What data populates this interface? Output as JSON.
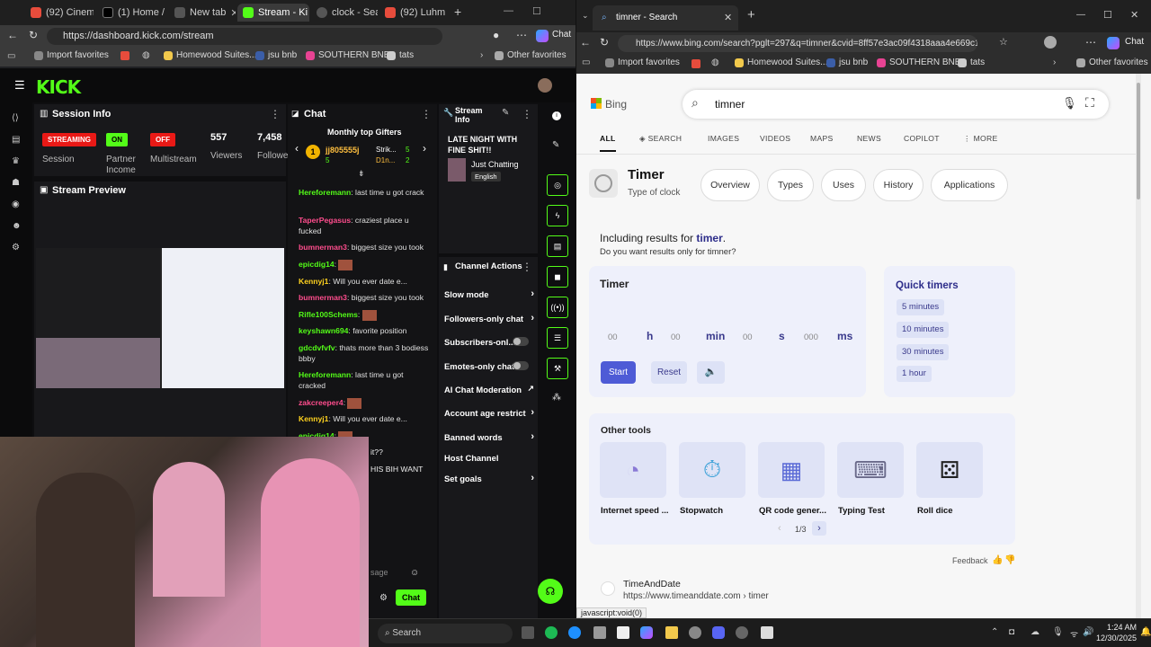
{
  "left_browser": {
    "tabs": [
      {
        "title": "(92) Cinem",
        "color": "#e74c3c"
      },
      {
        "title": "(1) Home /",
        "color": "#ffffff"
      },
      {
        "title": "New tab",
        "color": "#888888"
      },
      {
        "title": "Stream - Ki",
        "color": "#53fc18"
      },
      {
        "title": "clock - Sear",
        "color": "#555555"
      },
      {
        "title": "(92) Luhm",
        "color": "#e74c3c"
      }
    ],
    "url": "https://dashboard.kick.com/stream",
    "chat_label": "Chat",
    "favorites": [
      "Import favorites",
      "Homewood Suites...",
      "jsu bnb",
      "SOUTHERN BNB'",
      "tats",
      "Other favorites"
    ]
  },
  "kick": {
    "logo": "KICK",
    "session": {
      "title": "Session Info",
      "streaming_badge": "STREAMING",
      "on_badge": "ON",
      "off_badge": "OFF",
      "session_label": "Session",
      "partner_label": "Partner Income",
      "multistream_label": "Multistream",
      "viewers_value": "557",
      "viewers_label": "Viewers",
      "followers_value": "7,458",
      "followers_label": "Followe"
    },
    "preview_title": "Stream Preview",
    "chat": {
      "title": "Chat",
      "gifters_title": "Monthly top Gifters",
      "gifter1": "jj805555j",
      "gifter1_count": "5",
      "gifter2": "Strik...",
      "gifter2_count": "5",
      "gifter3": "D1n...",
      "gifter3_count": "2",
      "messages": [
        {
          "user": "Hereforemann",
          "text": "last time u got crack",
          "color": "#53fc18"
        },
        {
          "user": "TaperPegasus",
          "text": "craziest place u fucked",
          "color": "#ff4d8d"
        },
        {
          "user": "bumnerman3",
          "text": "biggest size you took",
          "color": "#ff4d8d"
        },
        {
          "user": "epicdig14",
          "text": "",
          "color": "#53fc18"
        },
        {
          "user": "Kennyj1",
          "text": "Will you ever date e...",
          "color": "#ffd21f"
        },
        {
          "user": "bumnerman3",
          "text": "biggest size you took",
          "color": "#ff4d8d"
        },
        {
          "user": "Rifle100Schems",
          "text": "",
          "color": "#53fc18"
        },
        {
          "user": "keyshawn694",
          "text": "favorite position",
          "color": "#53fc18"
        },
        {
          "user": "gdcdvfvfv",
          "text": "thats more than 3 bodiess bbby",
          "color": "#53fc18"
        },
        {
          "user": "Hereforemann",
          "text": "last time u got cracked",
          "color": "#53fc18"
        },
        {
          "user": "zakcreeper4",
          "text": "",
          "color": "#ff4d8d"
        },
        {
          "user": "Kennyj1",
          "text": "Will you ever date e...",
          "color": "#ffd21f"
        },
        {
          "user": "epicdig14",
          "text": "",
          "color": "#53fc18"
        }
      ],
      "partial_1": "it??",
      "partial_2": "HIS BIH WANT",
      "input_placeholder": "sage",
      "send_label": "Chat"
    },
    "stream_info": {
      "title": "Stream Info",
      "stream_title": "LATE NIGHT WITH FINE SHIT!!",
      "category": "Just Chatting",
      "language": "English"
    },
    "channel_actions": {
      "title": "Channel Actions",
      "items": [
        "Slow mode",
        "Followers-only chat",
        "Subscribers-onl...",
        "Emotes-only chat",
        "AI Chat Moderation",
        "Account age restrict",
        "Banned words",
        "Host Channel",
        "Set goals"
      ]
    }
  },
  "right_browser": {
    "tab_title": "timner - Search",
    "url": "https://www.bing.com/search?pglt=297&q=timner&cvid=8ff57e3ac09f4318aaa4e669c10...",
    "chat_label": "Chat",
    "favorites": [
      "Import favorites",
      "Homewood Suites...",
      "jsu bnb",
      "SOUTHERN BNB'",
      "tats",
      "Other favorites"
    ]
  },
  "bing": {
    "logo": "Bing",
    "query": "timner",
    "nav": [
      "ALL",
      "SEARCH",
      "IMAGES",
      "VIDEOS",
      "MAPS",
      "NEWS",
      "COPILOT",
      "MORE"
    ],
    "entity_title": "Timer",
    "entity_subtitle": "Type of clock",
    "pills": [
      "Overview",
      "Types",
      "Uses",
      "History",
      "Applications"
    ],
    "including_prefix": "Including results for ",
    "including_term": "timer",
    "did_you_mean": "Do you want results only for timner?",
    "timer": {
      "title": "Timer",
      "h_value": "00",
      "h_unit": "h",
      "min_value": "00",
      "min_unit": "min",
      "s_value": "00",
      "s_unit": "s",
      "ms_value": "000",
      "ms_unit": "ms",
      "start": "Start",
      "reset": "Reset"
    },
    "quick_timers": {
      "title": "Quick timers",
      "items": [
        "5 minutes",
        "10 minutes",
        "30 minutes",
        "1 hour"
      ]
    },
    "other_tools": {
      "title": "Other tools",
      "items": [
        "Internet speed ...",
        "Stopwatch",
        "QR code gener...",
        "Typing Test",
        "Roll dice"
      ],
      "pagination": "1/3"
    },
    "feedback": "Feedback",
    "result": {
      "site": "TimeAndDate",
      "url": "https://www.timeanddate.com › timer"
    },
    "status_bar": "javascript:void(0)"
  },
  "taskbar": {
    "search": "Search",
    "time": "1:24 AM",
    "date": "12/30/2025"
  },
  "colors": {
    "kick_green": "#53fc18",
    "bing_blue": "#4e5bd6",
    "streaming_red": "#e91916"
  }
}
